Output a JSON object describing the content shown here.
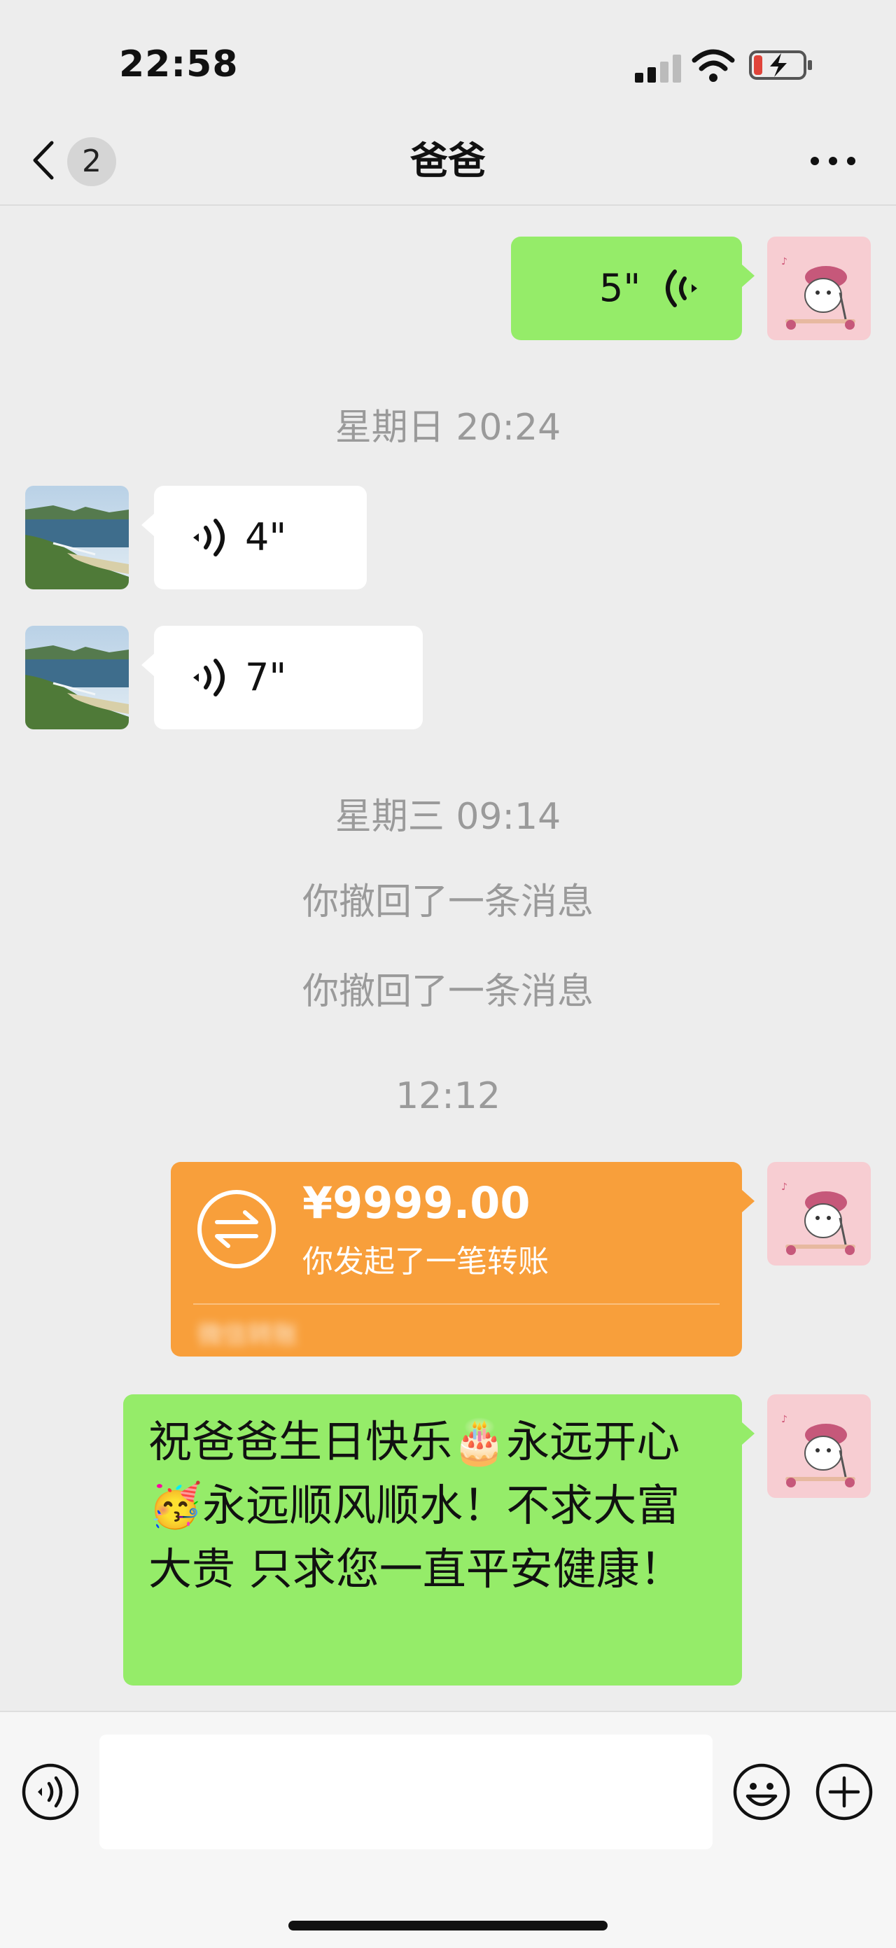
{
  "status_bar": {
    "time": "22:58"
  },
  "header": {
    "back_label": "<",
    "unread_count": "2",
    "title": "爸爸",
    "more_label": "..."
  },
  "messages": {
    "voice_sent": {
      "duration": "5\""
    },
    "ts1": "星期日 20:24",
    "voice_recv_1": {
      "duration": "4\""
    },
    "voice_recv_2": {
      "duration": "7\""
    },
    "ts2": "星期三 09:14",
    "recall_1": "你撤回了一条消息",
    "recall_2": "你撤回了一条消息",
    "ts3": "12:12",
    "transfer": {
      "amount": "¥9999.00",
      "description": "你发起了一笔转账",
      "footer": "微信转账"
    },
    "text_1": "祝爸爸生日快乐🎂永远开心🥳永远顺风顺水！不求大富大贵 只求您一直平安健康！"
  },
  "colors": {
    "background": "#ededed",
    "sent_bubble": "#95ec69",
    "received_bubble": "#ffffff",
    "transfer_card": "#f89f3b",
    "timestamp_text": "#9a9a9a"
  },
  "icons": {
    "back": "chevron-left-icon",
    "more": "more-icon",
    "voice_input": "voice-icon",
    "emoji": "emoji-icon",
    "add": "plus-icon",
    "transfer": "transfer-arrows-icon"
  }
}
